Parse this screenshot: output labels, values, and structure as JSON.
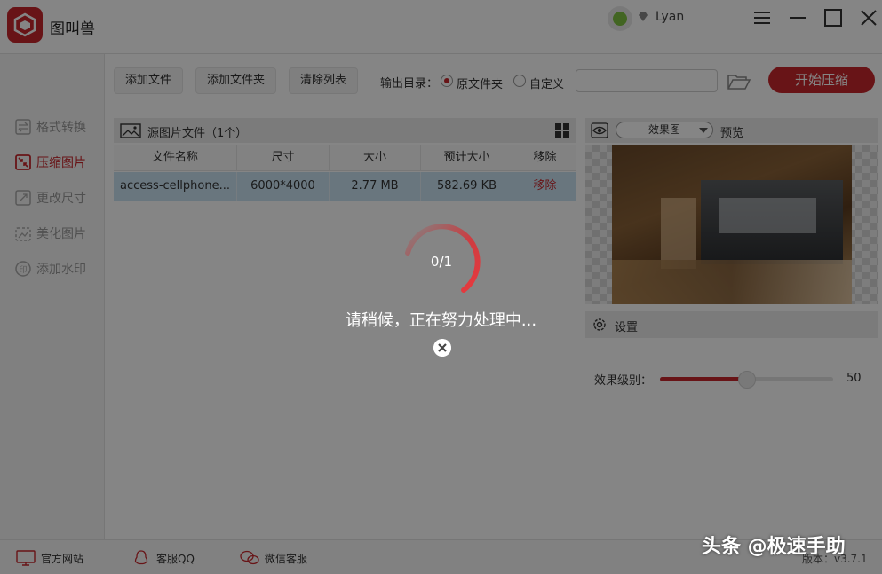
{
  "app": {
    "title": "图叫兽",
    "username": "Lyan"
  },
  "colors": {
    "accent": "#c8282d",
    "selected_row": "#c9e3f2"
  },
  "sidebar": {
    "items": [
      {
        "label": "格式转换",
        "icon": "format-convert-icon",
        "active": false
      },
      {
        "label": "压缩图片",
        "icon": "compress-icon",
        "active": true
      },
      {
        "label": "更改尺寸",
        "icon": "resize-icon",
        "active": false
      },
      {
        "label": "美化图片",
        "icon": "beautify-icon",
        "active": false
      },
      {
        "label": "添加水印",
        "icon": "watermark-icon",
        "active": false
      }
    ]
  },
  "toolbar": {
    "add_file": "添加文件",
    "add_folder": "添加文件夹",
    "clear_list": "清除列表",
    "output_label": "输出目录：",
    "option_original": "原文件夹",
    "option_custom": "自定义",
    "path_value": "",
    "start_button": "开始压缩"
  },
  "file_panel": {
    "title": "源图片文件（1个）",
    "columns": [
      "文件名称",
      "尺寸",
      "大小",
      "预计大小",
      "移除"
    ],
    "rows": [
      {
        "name": "access-cellphone...",
        "dimensions": "6000*4000",
        "size": "2.77 MB",
        "estimated": "582.69 KB",
        "remove": "移除"
      }
    ]
  },
  "preview": {
    "mode_select": "效果图",
    "label": "预览"
  },
  "settings": {
    "title": "设置",
    "level_label": "效果级别：",
    "level_value": "50",
    "level_fraction": 0.5
  },
  "statusbar": {
    "website": "官方网站",
    "qq": "客服QQ",
    "wechat": "微信客服",
    "version": "版本：v3.7.1"
  },
  "overlay": {
    "progress": "0/1",
    "message": "请稍候，正在努力处理中..."
  },
  "watermark": {
    "text": "头条 @极速手助"
  }
}
